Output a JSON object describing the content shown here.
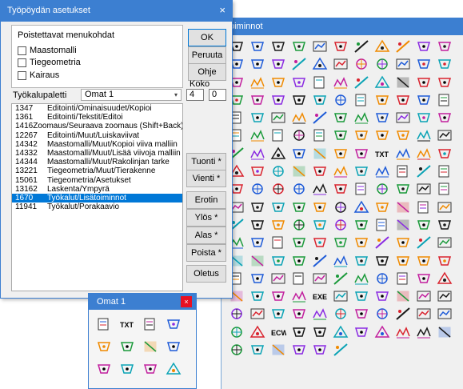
{
  "palette": {
    "title": "oiminnot",
    "rows": [
      [
        "pt-add",
        "pt-angle",
        "pt-arrow",
        "pt-plus",
        "doc-pts",
        "doc-pt",
        "doc-pts2",
        "doc-sel",
        "doc-sel2",
        "doc-arrow",
        "doc-right"
      ],
      [
        "pt-dashed",
        "pt-move",
        "landxml",
        "qmark",
        "doc-mark",
        "doc-flag",
        "doc-log",
        "doc-pipe",
        "doc-copy",
        "doc-calc",
        "table"
      ],
      [
        "frame-small",
        "frame",
        "corner",
        "rect",
        "walker",
        "doc-link",
        "doc-sel3",
        "doc-ref",
        "doc-pin",
        "doc-table",
        "doc-table2"
      ],
      [
        "box",
        "box-arrow",
        "box-plus",
        "box-lr",
        "box-merge",
        "box-circle",
        "box-doc",
        "box-zoom",
        "box-left",
        "box-right",
        "box-help"
      ],
      [
        "crosshatch",
        "doc-no",
        "red-ban",
        "black-bar",
        "v-red",
        "v-purple",
        "image",
        "layers",
        "undo",
        "redo",
        "txt-star"
      ],
      [
        "red-q",
        "diag",
        "q-blue",
        "line-red",
        "tri-purple",
        "line-blue",
        "pen-multi",
        "pencil",
        "mesh",
        "grid",
        "bars"
      ],
      [
        "doc-grid",
        "pts-grid",
        "hatch",
        "hatch2",
        "pipe",
        "num-grid",
        "pt-txt",
        "TXT",
        "txt-small",
        "ab-12",
        "num-x"
      ],
      [
        "doc-step",
        "star-grid",
        "hatch-green",
        "slope",
        "spiral",
        "slash",
        "cad",
        "hash-red",
        "triangle",
        "warn",
        "doc-last"
      ],
      [
        "target",
        "compass",
        "xy",
        "sin-cos",
        "sin-cos2",
        "v-check",
        "pt-plus-blue",
        "cone",
        "stamp",
        "C-letter",
        "chevron"
      ],
      [
        "red-bar",
        "pt-route",
        "rising",
        "hatch-pipe",
        "doc-dl",
        "road",
        "dots",
        "globe",
        "graph-x",
        "diag2",
        "hub"
      ],
      [
        "cyl",
        "mesh-circle",
        "mesh",
        "circle-cross",
        "frac",
        "grid-bar",
        "flat-lines",
        "ramp",
        "grid-flat",
        "hatch3",
        "dots-green"
      ],
      [
        "mag",
        "mesh-2",
        "ab-mesh",
        "mesh-3",
        "dot-mesh",
        "tools",
        "terrain",
        "flag-dir",
        "dots-blue",
        "dots-red",
        "end"
      ],
      [
        "grass",
        "poles",
        "chart",
        "blue-chart",
        "dig",
        "bars2",
        "stripes",
        "colors",
        "terrain2",
        "mountain",
        "m-dot"
      ],
      [
        "diag3",
        "arrows",
        "peak",
        "stroke",
        "lines",
        "up",
        "bars3",
        "road2",
        "river",
        "slope2",
        "hill"
      ],
      [
        "lines-12",
        "terrain3",
        "doc-grid2",
        "sheet",
        "EXE",
        "ruler",
        "cursor",
        "ruler2",
        "xyz",
        "doc-4",
        "doc-5"
      ],
      [
        "doc-gear",
        "wave",
        "doc-gear2",
        "terrain4",
        "map",
        "hash",
        "X-blue",
        "brush",
        "stack",
        "doc-6",
        "doc-7"
      ],
      [
        "peak2",
        "no-sign",
        "ECW",
        "layers2",
        "terrain5",
        "map2",
        "grass2",
        "map3",
        "flat",
        "glob",
        "done"
      ],
      [
        "green",
        "green-excl",
        "num-1",
        "hole-y",
        "purple",
        "info",
        "",
        "",
        "",
        "",
        ""
      ]
    ]
  },
  "dialog": {
    "title": "Työpöydän asetukset",
    "close_label": "×",
    "group_label": "Poistettavat menukohdat",
    "checkboxes": [
      {
        "label": "Maastomalli"
      },
      {
        "label": "Tiegeometria"
      },
      {
        "label": "Kairaus"
      }
    ],
    "buttons": {
      "ok": "OK",
      "cancel": "Peruuta",
      "help": "Ohje",
      "import": "Tuonti *",
      "export": "Vienti *",
      "separator": "Erotin",
      "up": "Ylös *",
      "down": "Alas *",
      "remove": "Poista *",
      "defaults": "Oletus"
    },
    "palette_label": "Työkalupaletti",
    "palette_value": "Omat 1",
    "size_label": "Koko",
    "size_w": "4",
    "size_h": "0",
    "list": [
      {
        "num": "1347",
        "text": "Editointi/Ominaisuudet/Kopioi"
      },
      {
        "num": "1361",
        "text": "Editointi/Tekstit/Editoi"
      },
      {
        "num": "1416",
        "text": "Zoomaus/Seuraava zoomaus (Shift+Back)"
      },
      {
        "num": "12267",
        "text": "Editointi/Muut/Luiskaviivat"
      },
      {
        "num": "14342",
        "text": "Maastomalli/Muut/Kopioi viiva malliin"
      },
      {
        "num": "14332",
        "text": "Maastomalli/Muut/Lisää viivoja malliin"
      },
      {
        "num": "14344",
        "text": "Maastomalli/Muut/Rakolinjan tarke"
      },
      {
        "num": "13221",
        "text": "Tiegeometria/Muut/Tierakenne"
      },
      {
        "num": "15061",
        "text": "Tiegeometria/Asetukset"
      },
      {
        "num": "13162",
        "text": "Laskenta/Ympyrä"
      },
      {
        "num": "1670",
        "text": "Työkalut/Lisätoiminnot",
        "selected": true
      },
      {
        "num": "11941",
        "text": "Työkalut/Porakaavio"
      }
    ]
  },
  "omat": {
    "title": "Omat 1",
    "close_label": "×",
    "tools": [
      "stripes-red",
      "TXT",
      "arrow-box",
      "ruler-diag",
      "mesh",
      "mesh-green",
      "trend",
      "hatch-stripe",
      "pencil-black",
      "circle-target",
      "X-blue",
      "dotted-red"
    ]
  }
}
